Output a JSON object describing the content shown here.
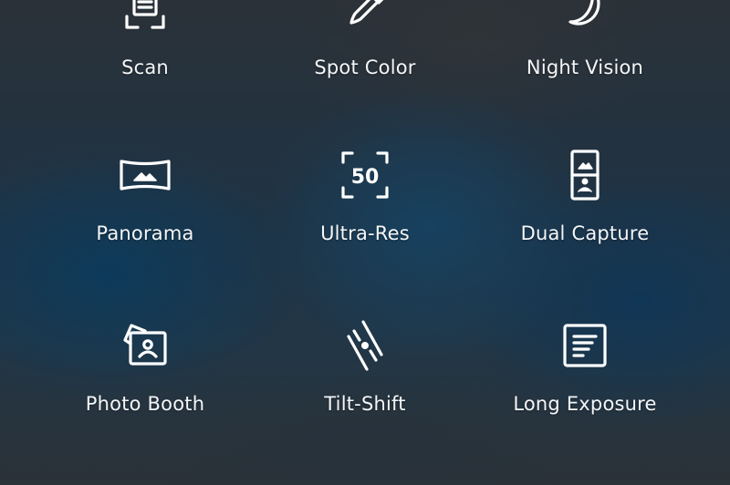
{
  "modes": [
    {
      "label": "Scan",
      "icon": "scan-icon"
    },
    {
      "label": "Spot Color",
      "icon": "eyedropper-icon"
    },
    {
      "label": "Night Vision",
      "icon": "moon-icon"
    },
    {
      "label": "Panorama",
      "icon": "panorama-icon"
    },
    {
      "label": "Ultra-Res",
      "icon": "ultra-res-icon",
      "icon_text": "50"
    },
    {
      "label": "Dual Capture",
      "icon": "dual-capture-icon"
    },
    {
      "label": "Photo Booth",
      "icon": "photo-booth-icon"
    },
    {
      "label": "Tilt-Shift",
      "icon": "tilt-shift-icon"
    },
    {
      "label": "Long Exposure",
      "icon": "long-exposure-icon"
    }
  ],
  "colors": {
    "icon_stroke": "#ffffff",
    "label_text": "#f4f6f8"
  }
}
